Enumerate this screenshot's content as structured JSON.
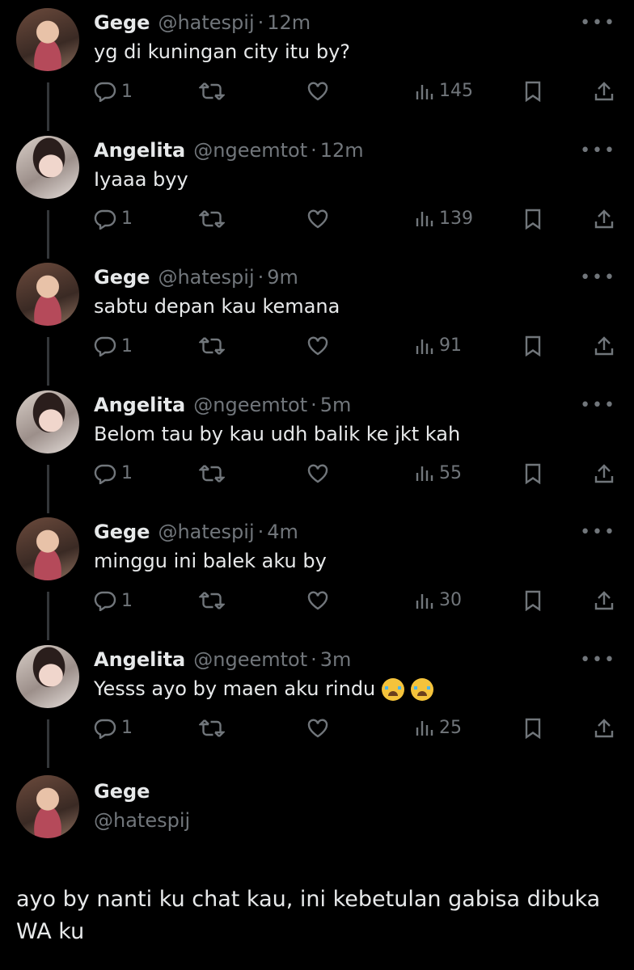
{
  "replies": [
    {
      "name": "Gege",
      "handle": "@hatespij",
      "dot": "·",
      "time": "12m",
      "text": "yg di kuningan city itu by?",
      "reply_count": "1",
      "views": "145",
      "avatar": "gege",
      "emoji_count": 0
    },
    {
      "name": "Angelita",
      "handle": "@ngeemtot",
      "dot": "·",
      "time": "12m",
      "text": "Iyaaa byy",
      "reply_count": "1",
      "views": "139",
      "avatar": "angel",
      "emoji_count": 0
    },
    {
      "name": "Gege",
      "handle": "@hatespij",
      "dot": "·",
      "time": "9m",
      "text": "sabtu depan kau kemana",
      "reply_count": "1",
      "views": "91",
      "avatar": "gege",
      "emoji_count": 0
    },
    {
      "name": "Angelita",
      "handle": "@ngeemtot",
      "dot": "·",
      "time": "5m",
      "text": "Belom tau by kau udh balik ke jkt kah",
      "reply_count": "1",
      "views": "55",
      "avatar": "angel",
      "emoji_count": 0
    },
    {
      "name": "Gege",
      "handle": "@hatespij",
      "dot": "·",
      "time": "4m",
      "text": "minggu ini balek aku by",
      "reply_count": "1",
      "views": "30",
      "avatar": "gege",
      "emoji_count": 0
    },
    {
      "name": "Angelita",
      "handle": "@ngeemtot",
      "dot": "·",
      "time": "3m",
      "text": "Yesss ayo by maen aku rindu",
      "reply_count": "1",
      "views": "25",
      "avatar": "angel",
      "emoji_count": 2
    }
  ],
  "main": {
    "name": "Gege",
    "handle": "@hatespij",
    "text": "ayo by nanti ku chat kau, ini kebetulan gabisa dibuka WA ku"
  },
  "more_label": "•••",
  "icons": {
    "reply": "reply-icon",
    "retweet": "retweet-icon",
    "like": "heart-icon",
    "views": "views-icon",
    "bookmark": "bookmark-icon",
    "share": "share-icon",
    "emoji": "loudly-crying-face-emoji"
  },
  "colors": {
    "background": "#000000",
    "text": "#e7e9ea",
    "secondary": "#71767b",
    "thread_line": "#333639"
  }
}
